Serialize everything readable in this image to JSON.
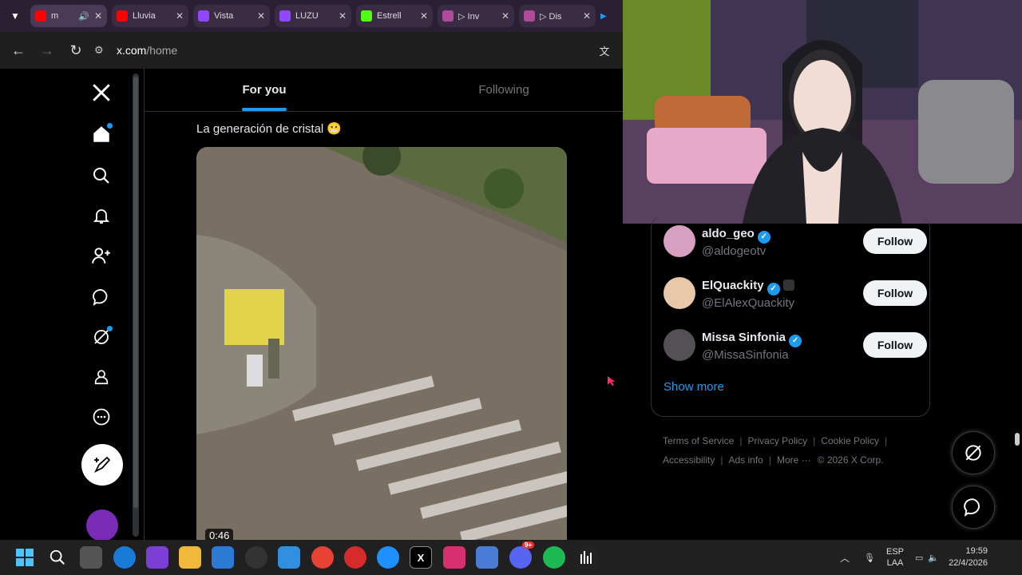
{
  "browser": {
    "tabs": [
      {
        "title": "m",
        "color": "#ff0000"
      },
      {
        "title": "Lluvia",
        "color": "#ff0000"
      },
      {
        "title": "Vista",
        "color": "#9146ff"
      },
      {
        "title": "LUZU",
        "color": "#9146ff"
      },
      {
        "title": "Estrell",
        "color": "#53fc18"
      },
      {
        "title": "▷ Inv",
        "color": "#b04a9a"
      },
      {
        "title": "▷ Dis",
        "color": "#b04a9a"
      }
    ],
    "url_host": "x.com",
    "url_path": "/home"
  },
  "feed": {
    "tab_for_you": "For you",
    "tab_following": "Following",
    "post_text": "La generación de cristal 😬",
    "video_time": "0:46"
  },
  "who_to_follow": {
    "accounts": [
      {
        "name": "aldo_geo",
        "handle": "@aldogeotv",
        "button": "Follow",
        "avatar_color": "#d8a0c0"
      },
      {
        "name": "ElQuackity",
        "handle": "@ElAlexQuackity",
        "button": "Follow",
        "avatar_color": "#e8c8a8"
      },
      {
        "name": "Missa Sinfonia",
        "handle": "@MissaSinfonia",
        "button": "Follow",
        "avatar_color": "#555055"
      }
    ],
    "show_more": "Show more"
  },
  "footer": {
    "terms": "Terms of Service",
    "privacy": "Privacy Policy",
    "cookie": "Cookie Policy",
    "accessibility": "Accessibility",
    "ads": "Ads info",
    "more": "More ···",
    "copyright": "© 2026 X Corp."
  },
  "taskbar": {
    "lang_top": "ESP",
    "lang_bottom": "LAA",
    "time": "19:59",
    "date": "22/4/2026",
    "discord_badge": "9+"
  },
  "colors": {
    "accent": "#1d9bf0",
    "bg": "#000000",
    "border": "#2f3336"
  }
}
